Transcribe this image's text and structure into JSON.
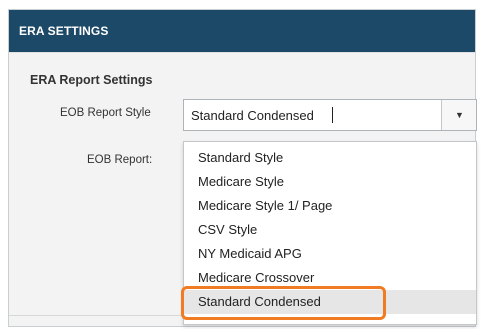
{
  "header": {
    "title": "ERA SETTINGS"
  },
  "section": {
    "title": "ERA Report Settings"
  },
  "fields": {
    "eob_report_style_label": "EOB Report Style",
    "eob_report_label": "EOB Report:"
  },
  "select": {
    "value": "Standard Condensed",
    "button_icon": "chevron-down-icon"
  },
  "dropdown": {
    "options": [
      "Standard Style",
      "Medicare Style",
      "Medicare Style 1/ Page",
      "CSV Style",
      "NY Medicaid APG",
      "Medicare Crossover",
      "Standard Condensed"
    ],
    "selected_index": 6
  },
  "colors": {
    "header_bg": "#1c4967",
    "highlight": "#f07b22"
  }
}
